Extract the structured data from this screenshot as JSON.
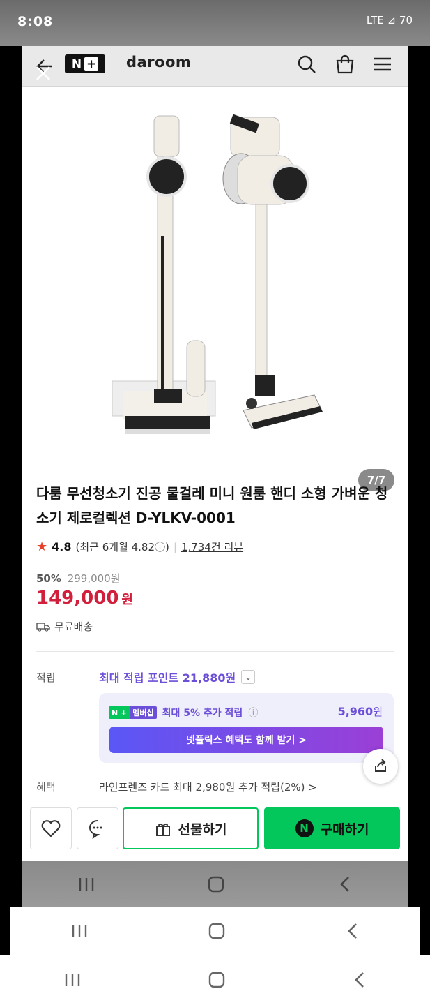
{
  "status": {
    "time": "8:08",
    "right": "LTE ⊿ 70"
  },
  "header": {
    "brand_badge_n": "N",
    "brand_badge_plus": "+",
    "brand": "daroom"
  },
  "product": {
    "pager": "7/7",
    "title": "다룸 무선청소기 진공 물걸레 미니 원룸 핸디 소형 가벼운 청소기 제로컬렉션 D-YLKV-0001",
    "rating": "4.8",
    "recent": "(최근 6개월 4.82ⓘ)",
    "reviews": "1,734건 리뷰",
    "discount_pct": "50%",
    "original_price": "299,000원",
    "price": "149,000",
    "price_unit": "원",
    "shipping": "무료배송"
  },
  "points": {
    "label": "적립",
    "max_points": "최대 적립 포인트 21,880원",
    "membership_tag_n": "N +",
    "membership_tag": "멤버십",
    "membership_text": "최대 5% 추가 적립",
    "membership_amount": "5,960",
    "membership_unit": "원",
    "netflix_button": "넷플릭스 혜택도 함께 받기 >"
  },
  "benefit": {
    "label": "혜택",
    "text": "라인프렌즈 카드 최대 2,980원 추가 적립(2%) >"
  },
  "actions": {
    "gift": "선물하기",
    "buy": "구매하기",
    "buy_logo": "N"
  },
  "colors": {
    "naver_green": "#03c75a",
    "price_red": "#d21f3c",
    "purple": "#6c4fd8"
  }
}
